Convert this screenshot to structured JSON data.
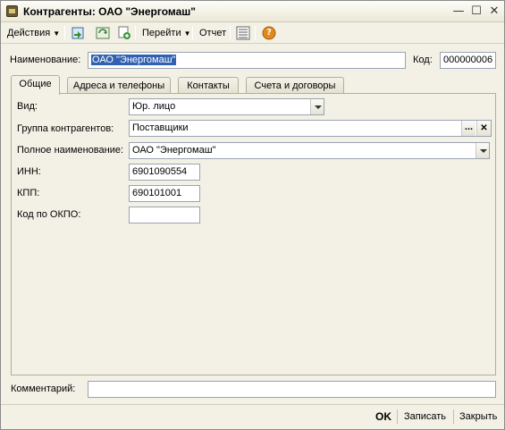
{
  "window": {
    "title": "Контрагенты: ОАО \"Энергомаш\"",
    "minimize_glyph": "—",
    "maximize_glyph": "☐",
    "close_glyph": "✕"
  },
  "toolbar": {
    "actions_label": "Действия",
    "goto_label": "Перейти",
    "report_label": "Отчет",
    "help_glyph": "?"
  },
  "header": {
    "name_label": "Наименование:",
    "name_value": "ОАО \"Энергомаш\"",
    "code_label": "Код:",
    "code_value": "000000006"
  },
  "tabs": [
    {
      "label": "Общие"
    },
    {
      "label": "Адреса и телефоны"
    },
    {
      "label": "Контакты"
    },
    {
      "label": "Счета и договоры"
    }
  ],
  "general": {
    "kind_label": "Вид:",
    "kind_value": "Юр. лицо",
    "group_label": "Группа контрагентов:",
    "group_value": "Поставщики",
    "group_choose_glyph": "...",
    "group_clear_glyph": "✕",
    "fullname_label": "Полное наименование:",
    "fullname_value": "ОАО \"Энергомаш\"",
    "inn_label": "ИНН:",
    "inn_value": "6901090554",
    "kpp_label": "КПП:",
    "kpp_value": "690101001",
    "okpo_label": "Код по ОКПО:",
    "okpo_value": ""
  },
  "comment": {
    "label": "Комментарий:",
    "value": ""
  },
  "footer": {
    "ok_label": "OK",
    "save_label": "Записать",
    "close_label": "Закрыть"
  },
  "colors": {
    "window_bg": "#f3f1e6",
    "selection": "#3161b0",
    "help_icon": "#e08a1e"
  }
}
